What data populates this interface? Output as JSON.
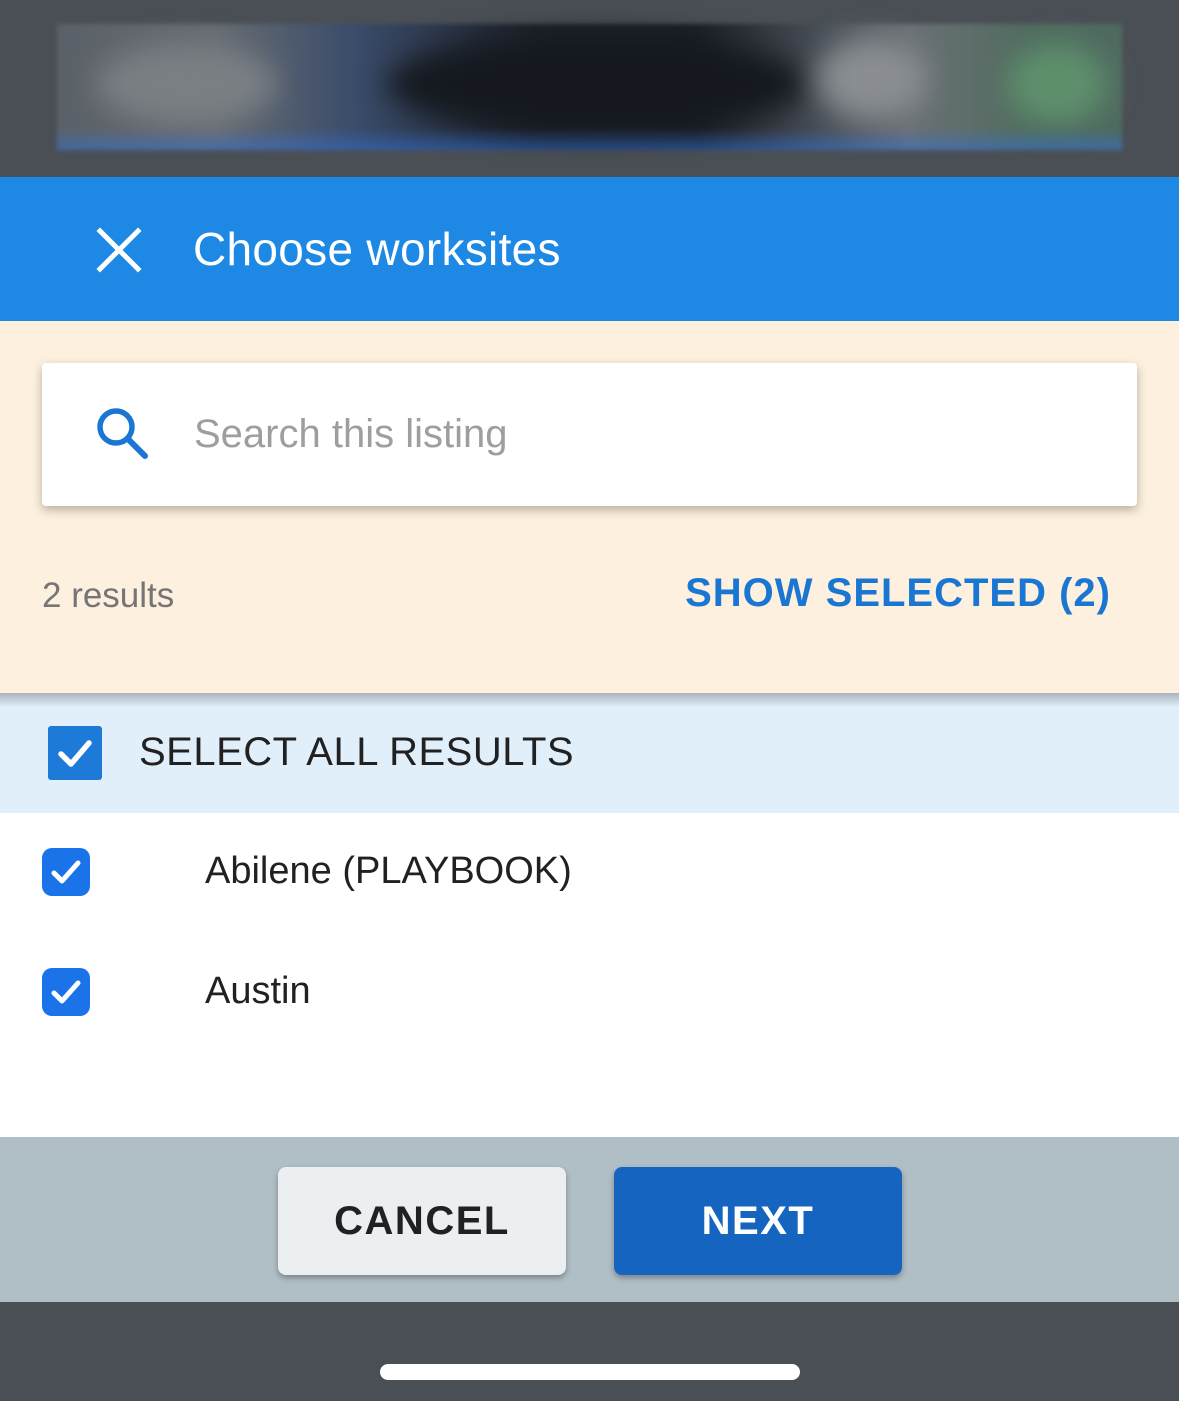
{
  "header": {
    "title": "Choose worksites",
    "close_icon": "close-icon"
  },
  "search": {
    "placeholder": "Search this listing",
    "value": "",
    "icon": "search-icon"
  },
  "results": {
    "count_label": "2 results",
    "show_selected_label": "SHOW SELECTED (2)"
  },
  "select_all": {
    "label": "SELECT ALL RESULTS",
    "checked": true
  },
  "items": [
    {
      "label": "Abilene (PLAYBOOK)",
      "checked": true
    },
    {
      "label": "Austin",
      "checked": true
    }
  ],
  "footer": {
    "cancel_label": "CANCEL",
    "next_label": "NEXT"
  },
  "colors": {
    "header_bg": "#1e88e5",
    "search_area_bg": "#fdf0de",
    "select_all_bg": "#e1effb",
    "footer_bg": "#b0bec5",
    "primary": "#1565c0",
    "link": "#1976d2"
  }
}
